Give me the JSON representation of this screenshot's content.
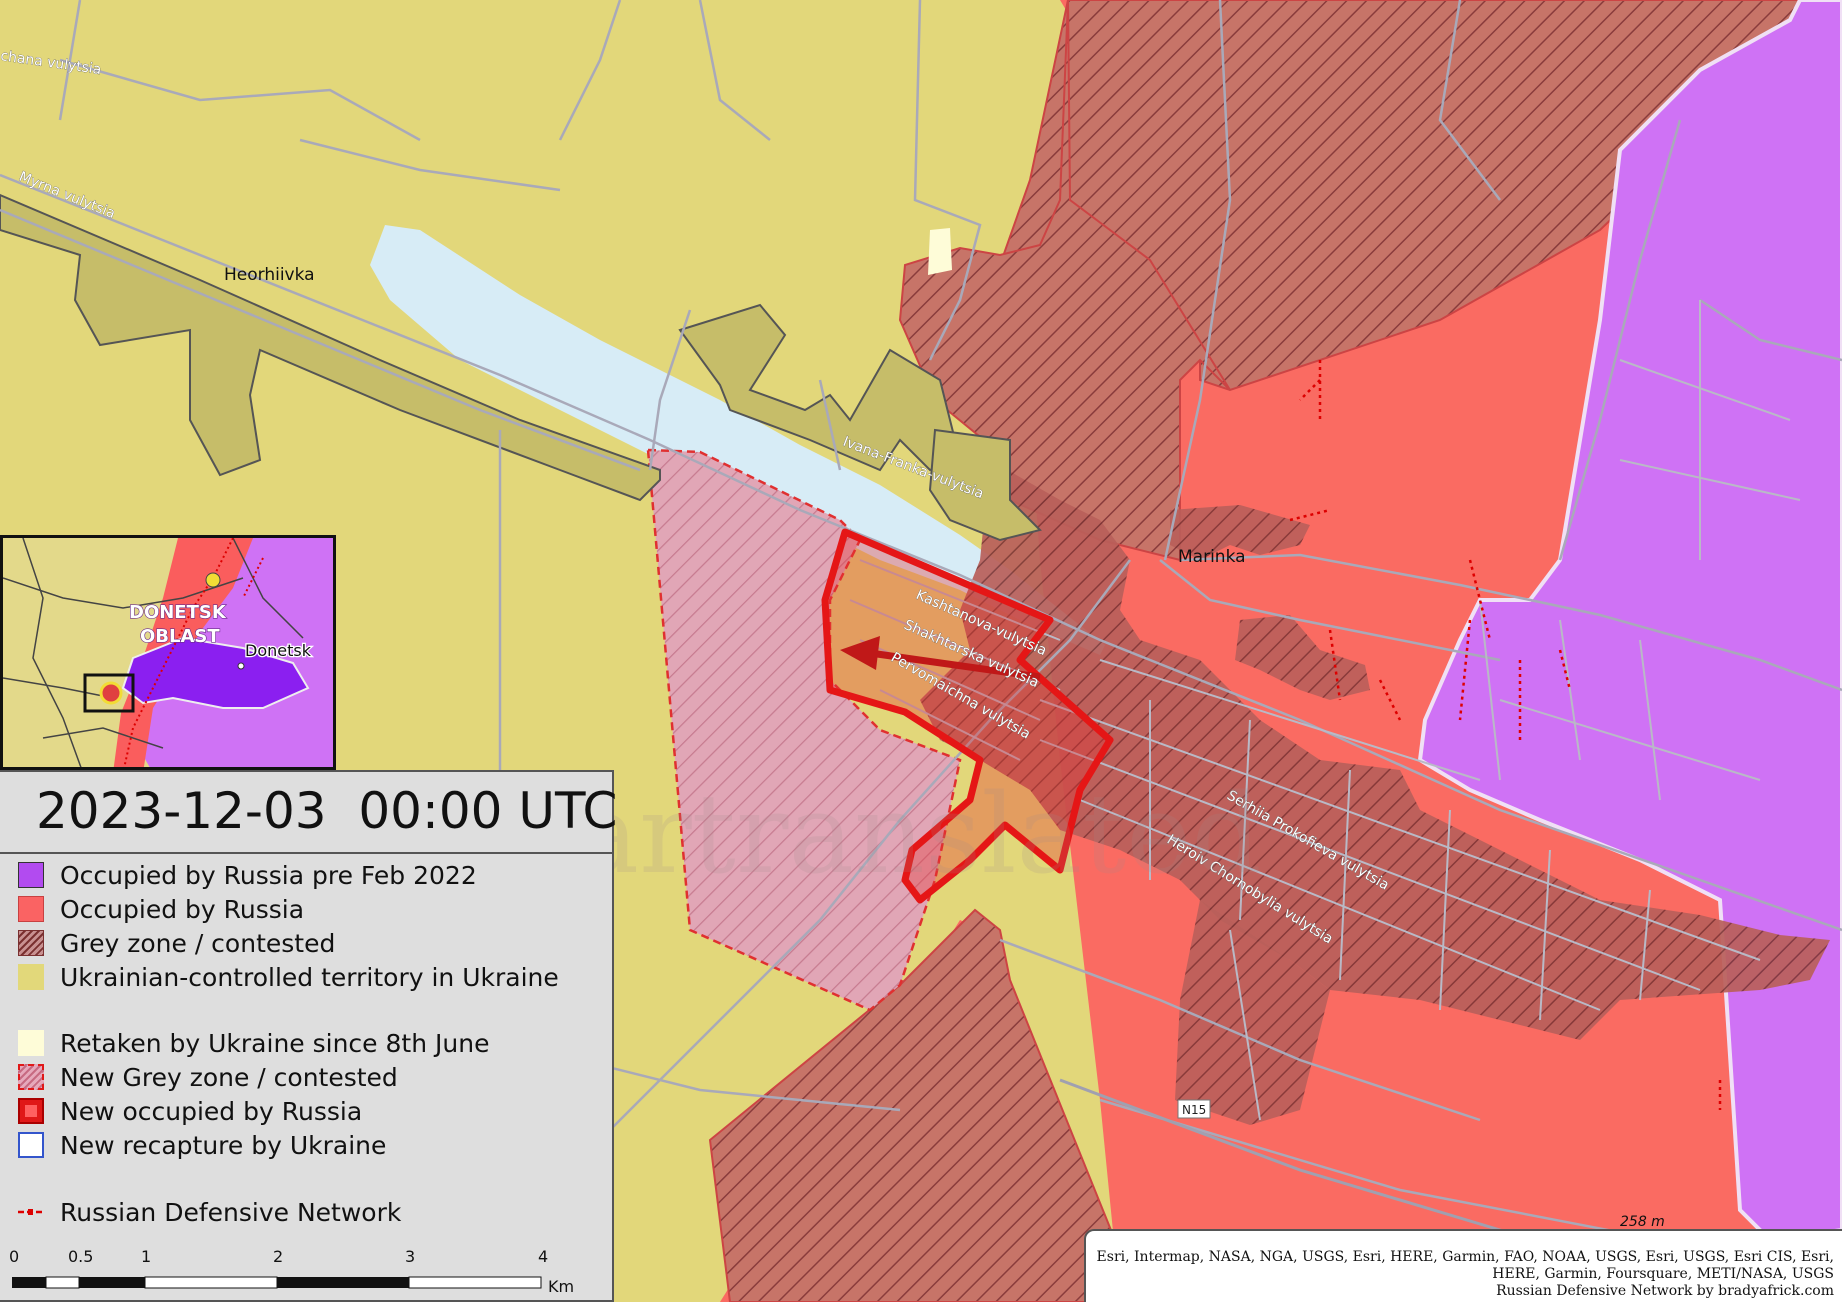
{
  "map": {
    "places": [
      {
        "name": "Heorhiivka"
      },
      {
        "name": "Marinka"
      }
    ],
    "streets": [
      "chana vulytsia",
      "Myrna vulytsia",
      "Ivana-Franka-vulytsia",
      "Kashtanova-vulytsia",
      "Shakhtarska vulytsia",
      "Pervomaichna vulytsia",
      "Serhiia Prokofieva vulytsia",
      "Heroiv Chornobylia vulytsia"
    ],
    "road_badge": "N15",
    "elevation_label": "258 m",
    "watermark": "Wartranslated",
    "colors": {
      "ukraine": "#e2d77a",
      "occupied_pre2022": "#cf72f5",
      "occupied": "#fa6b62",
      "grey_zone": "#c26060",
      "new_grey_zone": "#dc9fb2",
      "new_occupied_outline": "#e51616",
      "water": "#d7ecf6",
      "roads": "#a9a9b9"
    }
  },
  "inset": {
    "oblast_label_line1": "DONETSK",
    "oblast_label_line2": "OBLAST",
    "city_label": "Donetsk"
  },
  "legend": {
    "datetime": "2023-12-03  00:00 UTC",
    "items": [
      {
        "label": "Occupied by Russia pre Feb 2022",
        "swatch": "purple"
      },
      {
        "label": "Occupied by Russia",
        "swatch": "red"
      },
      {
        "label": "Grey zone / contested",
        "swatch": "hatched-red"
      },
      {
        "label": "Ukrainian-controlled territory in Ukraine",
        "swatch": "yellow"
      },
      {
        "label": "Retaken by Ukraine since 8th June",
        "swatch": "pale-yellow"
      },
      {
        "label": "New Grey zone / contested",
        "swatch": "dashed-pink"
      },
      {
        "label": "New occupied by Russia",
        "swatch": "red-outline"
      },
      {
        "label": "New recapture by Ukraine",
        "swatch": "white-blue"
      },
      {
        "label": "Russian Defensive Network",
        "swatch": "red-dashed-line"
      }
    ]
  },
  "scale": {
    "ticks": [
      "0",
      "0.5",
      "1",
      "2",
      "3",
      "4"
    ],
    "unit": "Km"
  },
  "credits": {
    "line1": "Esri, Intermap, NASA, NGA, USGS, Esri, HERE, Garmin, FAO, NOAA, USGS, Esri, USGS, Esri CIS, Esri,",
    "line2": "HERE, Garmin, Foursquare, METI/NASA, USGS",
    "line3": "Russian Defensive Network by bradyafrick.com"
  }
}
